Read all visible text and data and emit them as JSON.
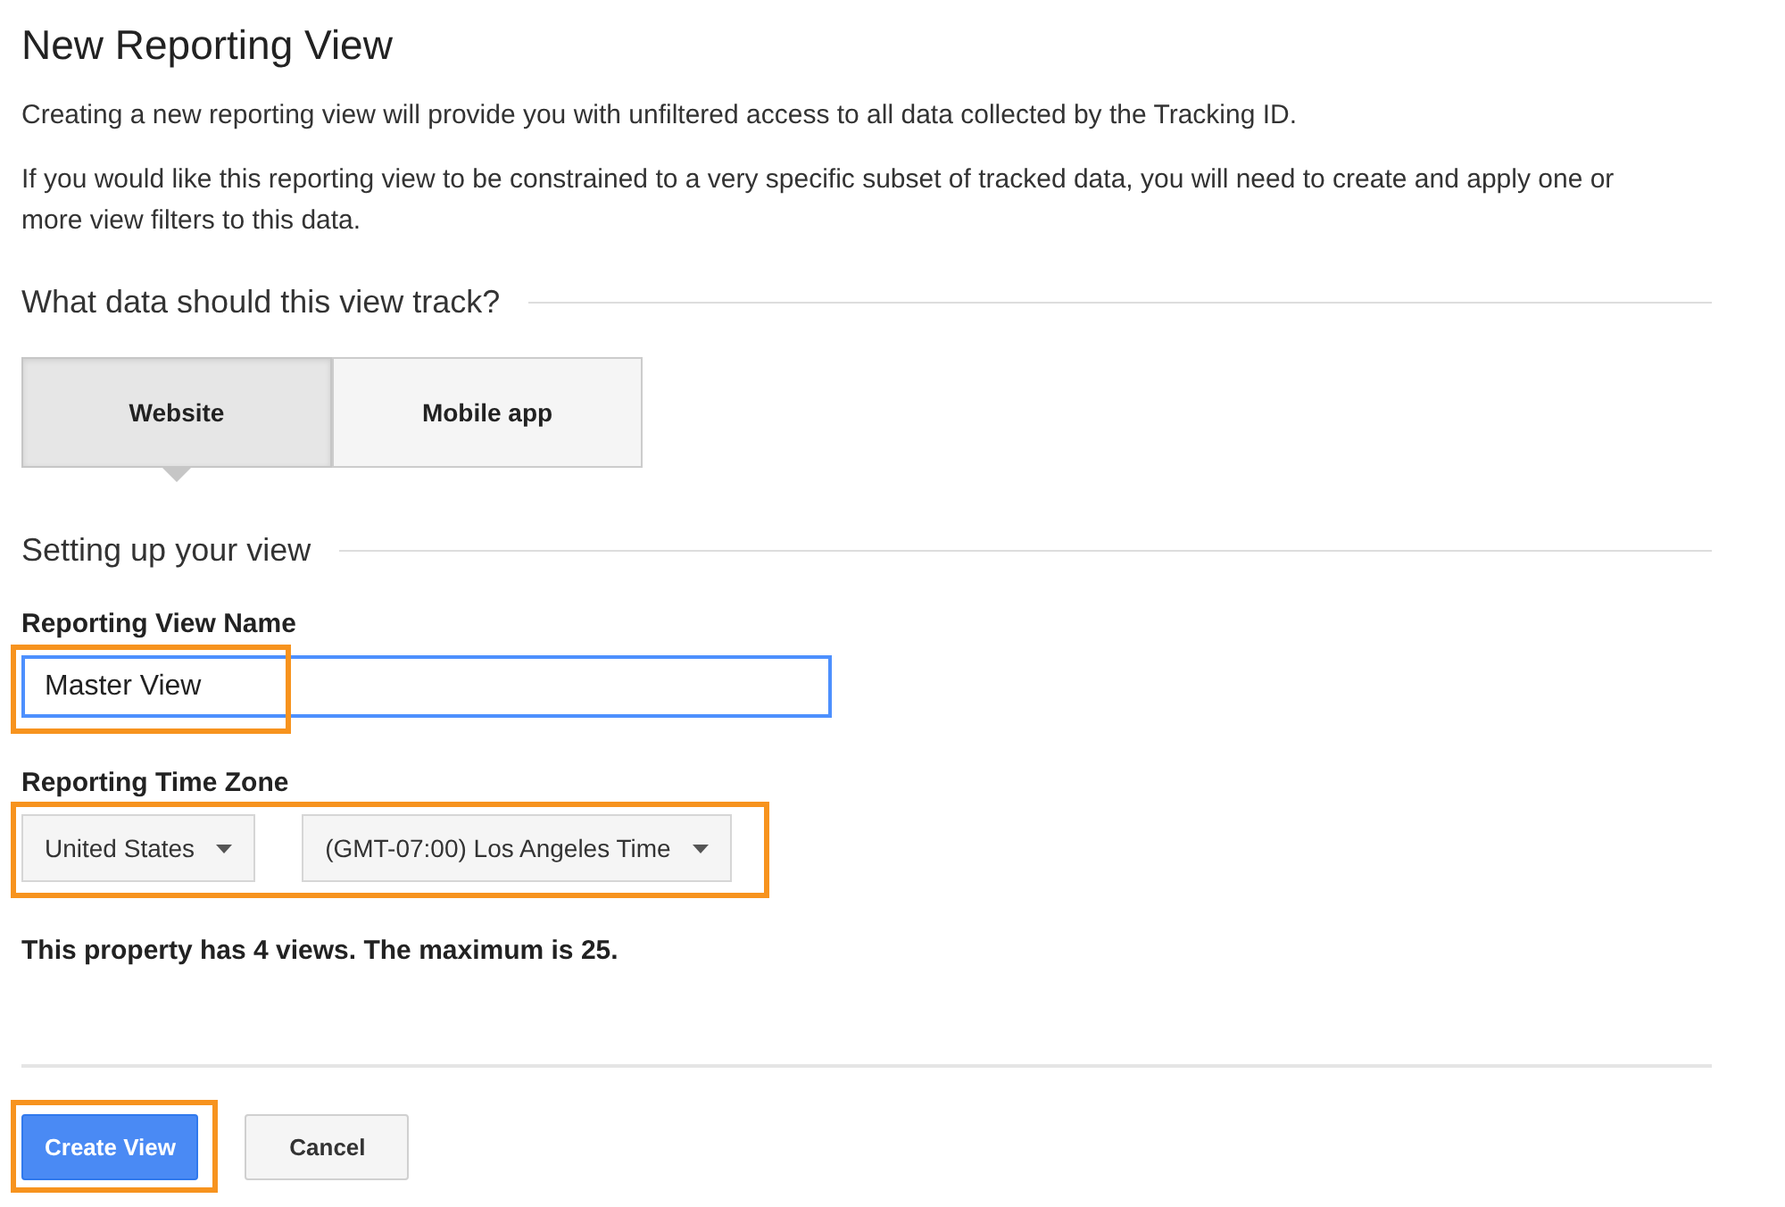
{
  "title": "New Reporting View",
  "intro": [
    "Creating a new reporting view will provide you with unfiltered access to all data collected by the Tracking ID.",
    "If you would like this reporting view to be constrained to a very specific subset of tracked data, you will need to create and apply one or more view filters to this data."
  ],
  "track_section": {
    "heading": "What data should this view track?",
    "tabs": [
      {
        "label": "Website",
        "selected": true
      },
      {
        "label": "Mobile app",
        "selected": false
      }
    ]
  },
  "setup_section": {
    "heading": "Setting up your view",
    "view_name": {
      "label": "Reporting View Name",
      "value": "Master View",
      "focused": true,
      "highlighted": true
    },
    "time_zone": {
      "label": "Reporting Time Zone",
      "highlighted": true,
      "dropdowns": [
        {
          "value": "United States"
        },
        {
          "value": "(GMT-07:00) Los Angeles Time"
        }
      ]
    },
    "note": "This property has 4 views. The maximum is 25."
  },
  "buttons": [
    {
      "label": "Create View",
      "kind": "primary",
      "highlighted": true
    },
    {
      "label": "Cancel",
      "kind": "secondary"
    }
  ]
}
